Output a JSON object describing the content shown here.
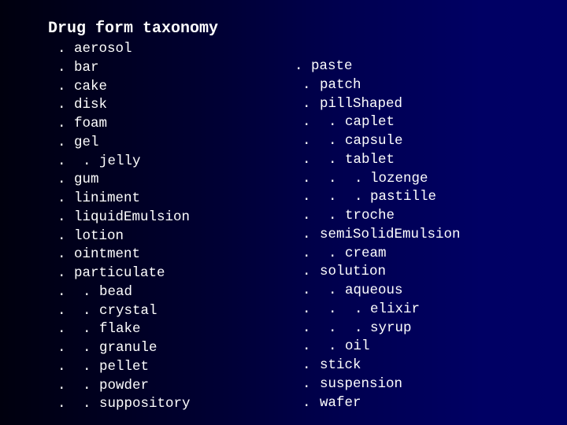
{
  "slide": {
    "title": "Drug form taxonomy",
    "bullet_glyph": ".",
    "left_column": [
      {
        "label": "aerosol",
        "level": 1
      },
      {
        "label": "bar",
        "level": 1
      },
      {
        "label": "cake",
        "level": 1
      },
      {
        "label": "disk",
        "level": 1
      },
      {
        "label": "foam",
        "level": 1
      },
      {
        "label": "gel",
        "level": 1
      },
      {
        "label": "jelly",
        "level": 2
      },
      {
        "label": "gum",
        "level": 1
      },
      {
        "label": "liniment",
        "level": 1
      },
      {
        "label": "liquidEmulsion",
        "level": 1
      },
      {
        "label": "lotion",
        "level": 1
      },
      {
        "label": "ointment",
        "level": 1
      },
      {
        "label": "particulate",
        "level": 1
      },
      {
        "label": "bead",
        "level": 2
      },
      {
        "label": "crystal",
        "level": 2
      },
      {
        "label": "flake",
        "level": 2
      },
      {
        "label": "granule",
        "level": 2
      },
      {
        "label": "pellet",
        "level": 2
      },
      {
        "label": "powder",
        "level": 2
      },
      {
        "label": "suppository",
        "level": 2
      }
    ],
    "right_column": [
      {
        "label": "paste",
        "level": 0
      },
      {
        "label": "patch",
        "level": 1
      },
      {
        "label": "pillShaped",
        "level": 1
      },
      {
        "label": "caplet",
        "level": 2
      },
      {
        "label": "capsule",
        "level": 2
      },
      {
        "label": "tablet",
        "level": 2
      },
      {
        "label": "lozenge",
        "level": 3
      },
      {
        "label": "pastille",
        "level": 3
      },
      {
        "label": "troche",
        "level": 2
      },
      {
        "label": "semiSolidEmulsion",
        "level": 1
      },
      {
        "label": "cream",
        "level": 2
      },
      {
        "label": "solution",
        "level": 1
      },
      {
        "label": "aqueous",
        "level": 2
      },
      {
        "label": "elixir",
        "level": 3
      },
      {
        "label": "syrup",
        "level": 3
      },
      {
        "label": "oil",
        "level": 2
      },
      {
        "label": "stick",
        "level": 1
      },
      {
        "label": "suspension",
        "level": 1
      },
      {
        "label": "wafer",
        "level": 1
      }
    ]
  },
  "colors": {
    "background_left": "#00000e",
    "background_right": "#000066",
    "text": "#ffffff"
  }
}
